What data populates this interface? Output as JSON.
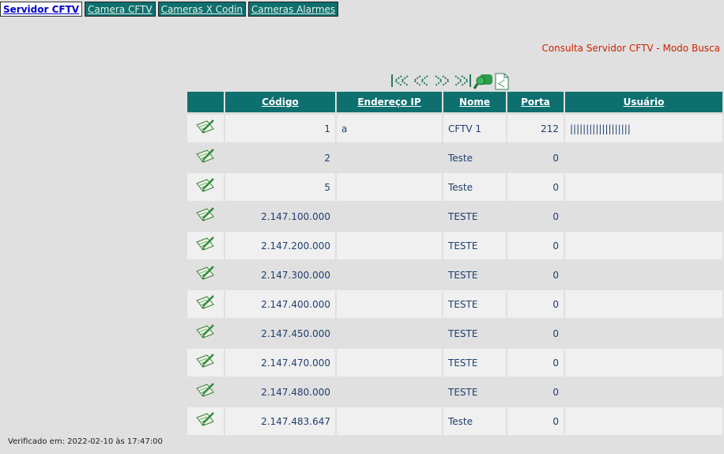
{
  "tabs": [
    {
      "label": "Servidor CFTV",
      "active": true
    },
    {
      "label": "Camera CFTV",
      "active": false
    },
    {
      "label": "Cameras X Codin",
      "active": false
    },
    {
      "label": "Cameras Alarmes",
      "active": false
    }
  ],
  "page_title": "Consulta Servidor CFTV - Modo Busca",
  "toolbar": {
    "icons": [
      "first-page-icon",
      "previous-page-icon",
      "next-page-icon",
      "last-page-icon",
      "search-binoculars-icon",
      "export-document-icon"
    ]
  },
  "table": {
    "headers": [
      "Código",
      "Endereço IP",
      "Nome",
      "Porta",
      "Usuário"
    ],
    "rows": [
      {
        "codigo": "1",
        "ip": "a",
        "nome": "CFTV 1",
        "porta": "212",
        "usuario": "|||||||||||||||||||"
      },
      {
        "codigo": "2",
        "ip": "",
        "nome": "Teste",
        "porta": "0",
        "usuario": ""
      },
      {
        "codigo": "5",
        "ip": "",
        "nome": "Teste",
        "porta": "0",
        "usuario": ""
      },
      {
        "codigo": "2.147.100.000",
        "ip": "",
        "nome": "TESTE",
        "porta": "0",
        "usuario": ""
      },
      {
        "codigo": "2.147.200.000",
        "ip": "",
        "nome": "TESTE",
        "porta": "0",
        "usuario": ""
      },
      {
        "codigo": "2.147.300.000",
        "ip": "",
        "nome": "TESTE",
        "porta": "0",
        "usuario": ""
      },
      {
        "codigo": "2.147.400.000",
        "ip": "",
        "nome": "TESTE",
        "porta": "0",
        "usuario": ""
      },
      {
        "codigo": "2.147.450.000",
        "ip": "",
        "nome": "TESTE",
        "porta": "0",
        "usuario": ""
      },
      {
        "codigo": "2.147.470.000",
        "ip": "",
        "nome": "TESTE",
        "porta": "0",
        "usuario": ""
      },
      {
        "codigo": "2.147.480.000",
        "ip": "",
        "nome": "TESTE",
        "porta": "0",
        "usuario": ""
      },
      {
        "codigo": "2.147.483.647",
        "ip": "",
        "nome": "Teste",
        "porta": "0",
        "usuario": ""
      }
    ]
  },
  "footer": {
    "text": "Verificado em: 2022-02-10 às 17:47:00"
  },
  "colors": {
    "header_bg": "#0e6f6f",
    "title": "#cc2200",
    "text": "#1f3f6f",
    "row_alt": "#f0f0f0"
  }
}
